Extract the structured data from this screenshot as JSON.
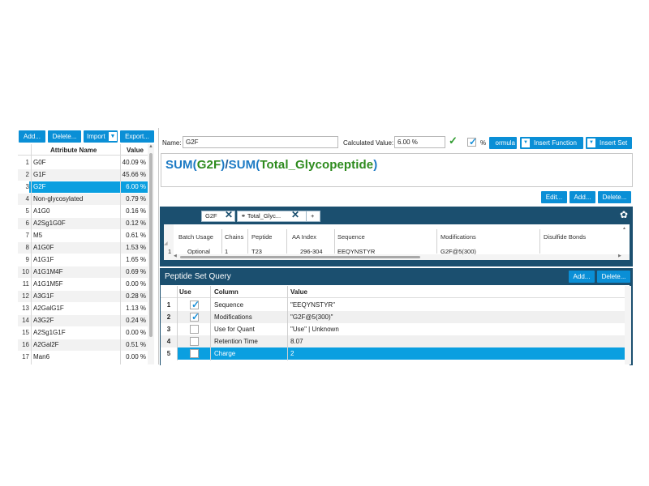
{
  "left_toolbar": {
    "add": "Add...",
    "delete": "Delete...",
    "import": "Import",
    "export": "Export..."
  },
  "attributes": {
    "headers": {
      "name": "Attribute Name",
      "value": "Value"
    },
    "rows": [
      {
        "n": "1",
        "name": "G0F",
        "value": "40.09 %"
      },
      {
        "n": "2",
        "name": "G1F",
        "value": "45.66 %"
      },
      {
        "n": "3",
        "name": "G2F",
        "value": "6.00 %"
      },
      {
        "n": "4",
        "name": "Non-glycosylated",
        "value": "0.79 %"
      },
      {
        "n": "5",
        "name": "A1G0",
        "value": "0.16 %"
      },
      {
        "n": "6",
        "name": "A2Sg1G0F",
        "value": "0.12 %"
      },
      {
        "n": "7",
        "name": "M5",
        "value": "0.61 %"
      },
      {
        "n": "8",
        "name": "A1G0F",
        "value": "1.53 %"
      },
      {
        "n": "9",
        "name": "A1G1F",
        "value": "1.65 %"
      },
      {
        "n": "10",
        "name": "A1G1M4F",
        "value": "0.69 %"
      },
      {
        "n": "11",
        "name": "A1G1M5F",
        "value": "0.00 %"
      },
      {
        "n": "12",
        "name": "A3G1F",
        "value": "0.28 %"
      },
      {
        "n": "13",
        "name": "A2GalG1F",
        "value": "1.13 %"
      },
      {
        "n": "14",
        "name": "A3G2F",
        "value": "0.24 %"
      },
      {
        "n": "15",
        "name": "A2Sg1G1F",
        "value": "0.00 %"
      },
      {
        "n": "16",
        "name": "A2Gal2F",
        "value": "0.51 %"
      },
      {
        "n": "17",
        "name": "Man6",
        "value": "0.00 %"
      }
    ],
    "selected_row": "3"
  },
  "editor": {
    "name_label": "Name:",
    "name_value": "G2F",
    "calc_label": "Calculated Value:",
    "calc_value": "6.00 %",
    "percent_label": "%",
    "formula_btn": "ormula",
    "insert_function": "Insert Function",
    "insert_set": "Insert Set"
  },
  "formula": {
    "p1": "SUM",
    "p2": "(",
    "p3": "G2F",
    "p4": ")",
    "p5": "/",
    "p6": "SUM",
    "p7": "(",
    "p8": "Total_Glycopeptide",
    "p9": ")"
  },
  "formula_actions": {
    "edit": "Edit...",
    "add": "Add...",
    "delete": "Delete..."
  },
  "peptide_tabs": {
    "tab1": "G2F",
    "tab2": "Total_Glyc...",
    "add": "+"
  },
  "peptide_table": {
    "headers": [
      "Batch Usage",
      "Chains",
      "Peptide",
      "AA Index",
      "Sequence",
      "Modifications",
      "Disulfide Bonds"
    ],
    "row": {
      "n": "1",
      "batch": "Optional",
      "chains": "1",
      "peptide": "T23",
      "aa": "296-304",
      "seq": "EEQYNSTYR",
      "mods": "G2F@5(300)"
    }
  },
  "query": {
    "title": "Peptide Set Query",
    "add": "Add...",
    "delete": "Delete...",
    "headers": {
      "use": "Use",
      "column": "Column",
      "value": "Value"
    },
    "rows": [
      {
        "n": "1",
        "checked": true,
        "column": "Sequence",
        "value": "\"EEQYNSTYR\""
      },
      {
        "n": "2",
        "checked": true,
        "column": "Modifications",
        "value": "\"G2F@5(300)\""
      },
      {
        "n": "3",
        "checked": false,
        "column": "Use for Quant",
        "value": "\"Use\" | Unknown"
      },
      {
        "n": "4",
        "checked": false,
        "column": "Retention Time",
        "value": "8.07"
      },
      {
        "n": "5",
        "checked": false,
        "column": "Charge",
        "value": "2"
      }
    ]
  },
  "colors": {
    "accent": "#0a8fd6",
    "panel_dark": "#1b4f6f",
    "selected": "#0a9fe0",
    "formula_green": "#2e8b1e",
    "formula_blue": "#1c7ac4"
  }
}
